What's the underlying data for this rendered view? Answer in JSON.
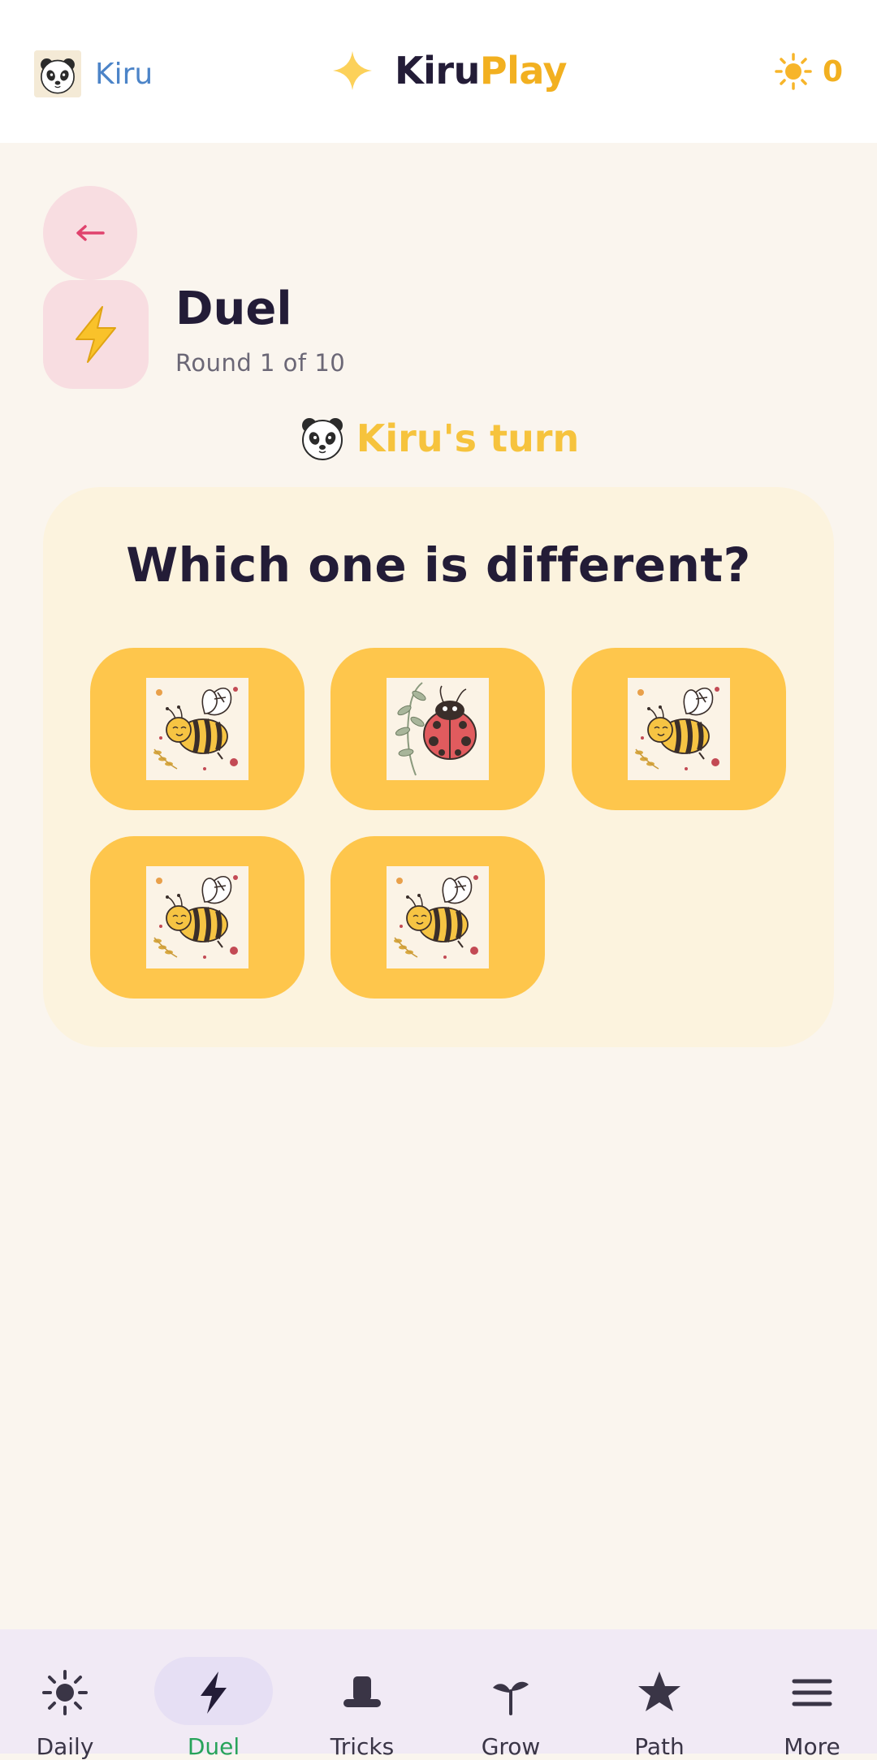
{
  "header": {
    "profile_name": "Kiru",
    "brand_part1": "Kiru",
    "brand_part2": "Play",
    "sun_count": "0"
  },
  "page": {
    "back_glyph": "←",
    "mode_icon": "lightning-icon",
    "title": "Duel",
    "subtitle": "Round 1 of 10",
    "turn_text": "Kiru's turn"
  },
  "question": {
    "prompt": "Which one is different?",
    "options": [
      {
        "image": "bee"
      },
      {
        "image": "ladybug"
      },
      {
        "image": "bee"
      },
      {
        "image": "bee"
      },
      {
        "image": "bee"
      }
    ]
  },
  "nav": {
    "items": [
      {
        "label": "Daily",
        "icon": "sun-icon"
      },
      {
        "label": "Duel",
        "icon": "lightning-icon",
        "active": true
      },
      {
        "label": "Tricks",
        "icon": "hat-icon"
      },
      {
        "label": "Grow",
        "icon": "sprout-icon"
      },
      {
        "label": "Path",
        "icon": "star-icon"
      },
      {
        "label": "More",
        "icon": "menu-icon"
      }
    ]
  },
  "colors": {
    "accent": "#f2b020",
    "option_bg": "#fec64c",
    "card_bg": "#fcf3de",
    "active_nav": "#27a35a",
    "back_bg": "#f8dde1"
  }
}
